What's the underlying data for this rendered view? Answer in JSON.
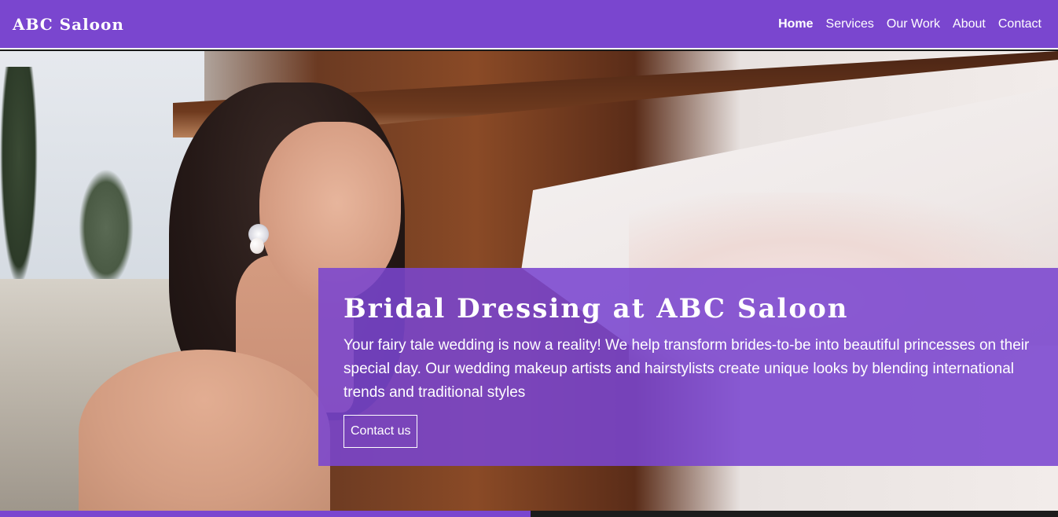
{
  "header": {
    "brand": "ABC Saloon",
    "nav": [
      {
        "label": "Home",
        "active": true
      },
      {
        "label": "Services",
        "active": false
      },
      {
        "label": "Our Work",
        "active": false
      },
      {
        "label": "About",
        "active": false
      },
      {
        "label": "Contact",
        "active": false
      }
    ]
  },
  "hero": {
    "title": "Bridal Dressing at ABC Saloon",
    "description": "Your fairy tale wedding is now a reality! We help transform brides-to-be into beautiful princesses on their special day. Our wedding makeup artists and hairstylists create unique looks by blending international trends and traditional styles",
    "cta_label": "Contact us"
  },
  "colors": {
    "brand_purple": "#7a46cf",
    "text": "#ffffff"
  }
}
